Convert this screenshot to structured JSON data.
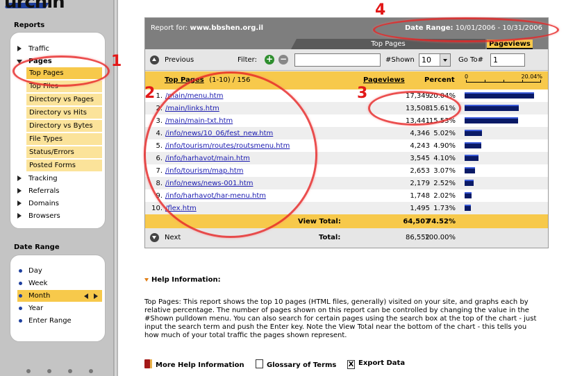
{
  "app": {
    "logo_text": "urchin"
  },
  "sidebar": {
    "reports_title": "Reports",
    "items": [
      {
        "label": "Traffic",
        "state": "collapsed"
      },
      {
        "label": "Pages",
        "state": "expanded"
      },
      {
        "label": "Tracking",
        "state": "collapsed"
      },
      {
        "label": "Referrals",
        "state": "collapsed"
      },
      {
        "label": "Domains",
        "state": "collapsed"
      },
      {
        "label": "Browsers",
        "state": "collapsed"
      }
    ],
    "pages_sub": [
      "Top Pages",
      "Top Files",
      "Directory vs Pages",
      "Directory vs Hits",
      "Directory vs Bytes",
      "File Types",
      "Status/Errors",
      "Posted Forms"
    ],
    "active_sub": "Top Pages",
    "date_range_title": "Date Range",
    "date_items": [
      "Day",
      "Week",
      "Month",
      "Year",
      "Enter Range"
    ],
    "active_date": "Month"
  },
  "report": {
    "report_for_label": "Report for:",
    "site": "www.bbshen.org.il",
    "date_range_label": "Date Range:",
    "date_range_value": "10/01/2006 - 10/31/2006",
    "tab_top_pages": "Top Pages",
    "tab_pageviews": "Pageviews",
    "toolbar": {
      "previous": "Previous",
      "filter": "Filter:",
      "filter_value": "",
      "shown_label": "#Shown",
      "shown_value": "10",
      "goto_label": "Go To#",
      "goto_value": "1",
      "next": "Next"
    },
    "columns": {
      "top_pages": "Top Pages",
      "range": "(1-10) / 156",
      "pageviews": "Pageviews",
      "percent": "Percent",
      "scale_min": "0",
      "scale_max": "20.04%"
    },
    "rows": [
      {
        "num": "1.",
        "page": "/main/menu.htm",
        "pageviews": "17,349",
        "percent": "20.04%",
        "pct_value": 20.04
      },
      {
        "num": "2.",
        "page": "/main/links.htm",
        "pageviews": "13,508",
        "percent": "15.61%",
        "pct_value": 15.61
      },
      {
        "num": "3.",
        "page": "/main/main-txt.htm",
        "pageviews": "13,441",
        "percent": "15.53%",
        "pct_value": 15.53
      },
      {
        "num": "4.",
        "page": "/info/news/10_06/fest_new.htm",
        "pageviews": "4,346",
        "percent": "5.02%",
        "pct_value": 5.02
      },
      {
        "num": "5.",
        "page": "/info/tourism/routes/routsmenu.htm",
        "pageviews": "4,243",
        "percent": "4.90%",
        "pct_value": 4.9
      },
      {
        "num": "6.",
        "page": "/info/harhavot/main.htm",
        "pageviews": "3,545",
        "percent": "4.10%",
        "pct_value": 4.1
      },
      {
        "num": "7.",
        "page": "/info/tourism/map.htm",
        "pageviews": "2,653",
        "percent": "3.07%",
        "pct_value": 3.07
      },
      {
        "num": "8.",
        "page": "/info/news/news-001.htm",
        "pageviews": "2,179",
        "percent": "2.52%",
        "pct_value": 2.52
      },
      {
        "num": "9.",
        "page": "/info/harhavot/har-menu.htm",
        "pageviews": "1,748",
        "percent": "2.02%",
        "pct_value": 2.02
      },
      {
        "num": "10.",
        "page": "/flex.htm",
        "pageviews": "1,495",
        "percent": "1.73%",
        "pct_value": 1.73
      }
    ],
    "view_total_label": "View Total:",
    "view_total_pageviews": "64,507",
    "view_total_percent": "74.52%",
    "total_label": "Total:",
    "total_pageviews": "86,552",
    "total_percent": "100.00%"
  },
  "annotations": {
    "n1": "1",
    "n2": "2",
    "n3": "3",
    "n4": "4",
    "color": "#e21919"
  },
  "help": {
    "title": "Help Information:",
    "text": "Top Pages: This report shows the top 10 pages (HTML files, generally) visited on your site, and graphs each by relative percentage. The number of pages shown on this report can be controlled by changing the value in the #Shown pulldown menu. You can also search for certain pages using the search box at the top of the chart - just input the search term and push the Enter key. Note the View Total near the bottom of the chart - this tells you how much of your total traffic the pages shown represent.",
    "links": [
      "More Help Information",
      "Glossary of Terms",
      "Export Data"
    ]
  },
  "colors": {
    "accent": "#f7c94b",
    "accent_light": "#fbe39a",
    "bar": "#0a1a66",
    "link": "#1a1ab0",
    "header": "#7e7e7e"
  }
}
